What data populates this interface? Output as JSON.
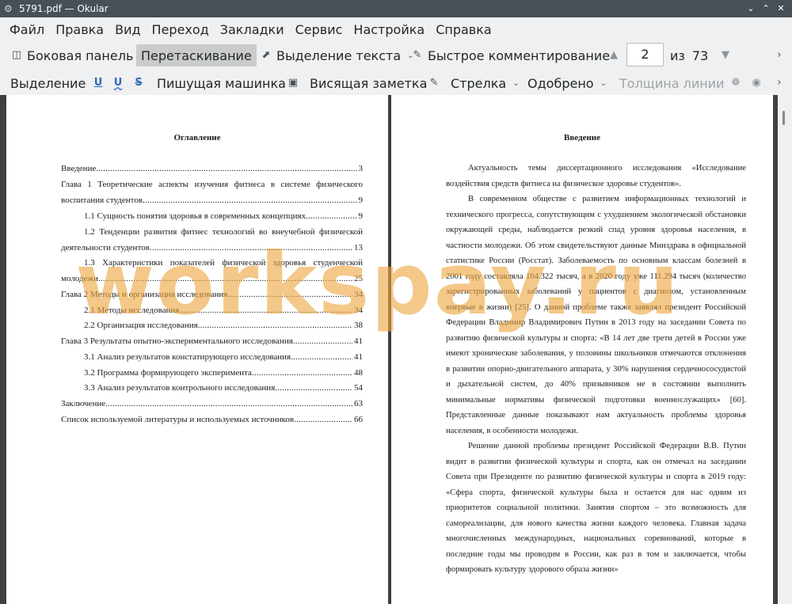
{
  "window": {
    "title": "5791.pdf — Okular"
  },
  "menubar": {
    "items": [
      "Файл",
      "Правка",
      "Вид",
      "Переход",
      "Закладки",
      "Сервис",
      "Настройка",
      "Справка"
    ]
  },
  "toolbar1": {
    "sidebar": "Боковая панель",
    "drag": "Перетаскивание",
    "text_select": "Выделение текста",
    "quick_annotate": "Быстрое комментирование",
    "page_current": "2",
    "page_of": "из",
    "page_total": "73"
  },
  "toolbar2": {
    "highlight": "Выделение",
    "typewriter": "Пишущая машинка",
    "popup_note": "Висящая заметка",
    "arrow": "Стрелка",
    "approved": "Одобрено",
    "line_width": "Толщина линии"
  },
  "left_page": {
    "heading": "Оглавление",
    "toc": [
      {
        "text": "Введение",
        "page": "3"
      },
      {
        "line1": "Глава 1 Теоретические аспекты изучения фитнеса в системе физического",
        "text": "воспитания студентов",
        "page": "9"
      },
      {
        "text": "1.1 Сущность понятия здоровья в современных концепциях",
        "page": "9"
      },
      {
        "line1": "1.2 Тенденции развития фитнес технологий во внеучебной физической",
        "text": "деятельности студентов",
        "page": "13"
      },
      {
        "line1": "1.3 Характеристики показателей физической здоровья студенческой",
        "text": "молодежи",
        "page": "25"
      },
      {
        "text": "Глава 2 Методы и организация исследования",
        "page": "34"
      },
      {
        "text": "2.1 Методы исследования",
        "page": "34"
      },
      {
        "text": "2.2 Организация исследования",
        "page": "38"
      },
      {
        "text": "Глава 3 Результаты опытно-экспериментального исследования",
        "page": "41"
      },
      {
        "text": "3.1 Анализ результатов констатирующего исследования",
        "page": "41"
      },
      {
        "text": "3.2 Программа формирующего эксперимента",
        "page": "48"
      },
      {
        "text": "3.3 Анализ результатов контрольного исследования",
        "page": "54"
      },
      {
        "text": "Заключение",
        "page": "63"
      },
      {
        "text": "Список используемой литературы и используемых источников",
        "page": "66"
      }
    ]
  },
  "right_page": {
    "heading": "Введение",
    "paragraphs": [
      "Актуальность темы диссертационного исследования «Исследование воздействия средств фитнеса на физическое здоровье студентов».",
      "В современном обществе с развитием информационных технологий и технического прогресса, сопутствующим с ухудшением экологической обстановки окружающей среды, наблюдается резкий спад уровня здоровья населения, в частности молодежи. Об этом свидетельствуют данные Минздрава в официальной статистике России (Росстат). Заболеваемость по основным классам болезней в 2001 году составляла 104.322 тысяч, а в 2020 году уже 111.294 тысяч (количество зарегистрированных заболеваний у пациентов с диагнозом, установленным впервые в жизни) [25]. О данной проблеме также заявлял президент Российской Федерации Владимир Владимирович Путин в 2013 году на заседании Совета по развитию физической культуры и спорта: «В 14 лет две трети детей в России уже имеют хронические заболевания, у половины школьников отмечаются отклонения в развитии опорно-двигательного аппарата, у 30% нарушения сердечнососудистой и дыхательной систем, до 40% призывников не в состоянии выполнить минимальные нормативы физической подготовки военнослужащих» [60]. Представленные данные показывают нам актуальность проблемы здоровья населения, в особенности молодежи.",
      "Решение данной проблемы президент Российской Федерации В.В. Путин видит в развитии физической культуры и спорта, как он отмечал на заседании Совета при Президенте по развитию физической культуры и спорта в 2019 году: «Сфера спорта, физической культуры была и остается для нас одним из приоритетов социальной политики. Занятия спортом – это возможность для самореализации, для нового качества жизни каждого человека. Главная задача многочисленных международных, национальных соревнований, которые в последние годы мы проводим в России, как раз в том и заключается, чтобы формировать культуру здорового образа жизни»"
    ]
  },
  "watermark": "workspay.ru",
  "colors": {
    "titlebar": "#475057",
    "watermark": "#eca640",
    "window_bg": "#eff0f1",
    "viewport_bg": "#404040"
  }
}
